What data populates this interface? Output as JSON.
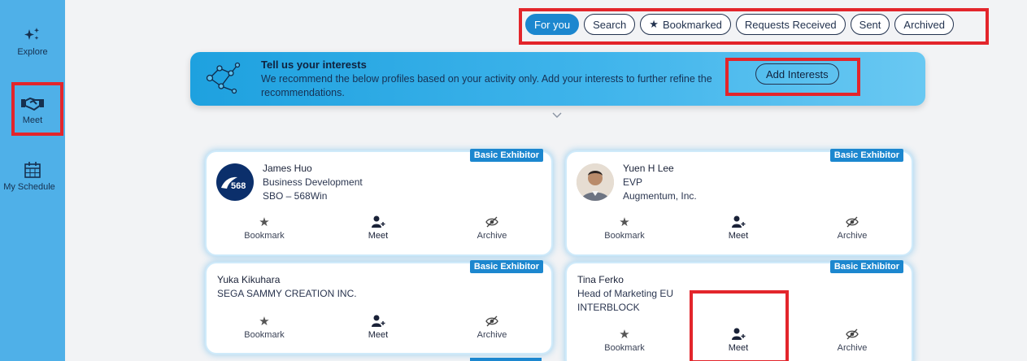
{
  "nav": {
    "items": [
      {
        "label": "Explore",
        "icon": "sparkles-icon"
      },
      {
        "label": "Meet",
        "icon": "handshake-icon"
      },
      {
        "label": "My Schedule",
        "icon": "calendar-icon"
      }
    ]
  },
  "tabs": [
    "For you",
    "Search",
    "Bookmarked",
    "Requests Received",
    "Sent",
    "Archived"
  ],
  "active_tab": "For you",
  "banner": {
    "title": "Tell us your interests",
    "text": "We recommend the below profiles based on your activity only. Add your interests to further refine the recommendations.",
    "button": "Add Interests"
  },
  "actions": {
    "bookmark": "Bookmark",
    "meet": "Meet",
    "archive": "Archive"
  },
  "cards": [
    {
      "badge": "Basic Exhibitor",
      "name": "James Huo",
      "title": "Business Development",
      "company": "SBO – 568Win",
      "avatar": "568win-logo"
    },
    {
      "badge": "Basic Exhibitor",
      "name": "Yuen H Lee",
      "title": "EVP",
      "company": "Augmentum, Inc.",
      "avatar": "person-photo"
    },
    {
      "badge": "Basic Exhibitor",
      "name": "Yuka Kikuhara",
      "title": "SEGA SAMMY CREATION INC.",
      "company": ""
    },
    {
      "badge": "Basic Exhibitor",
      "name": "Tina Ferko",
      "title": "Head of Marketing EU",
      "company": "INTERBLOCK"
    }
  ],
  "logo_text": "568",
  "colors": {
    "accent": "#1c87cf",
    "rail": "#4fb0e8",
    "highlight": "#e3252b"
  }
}
